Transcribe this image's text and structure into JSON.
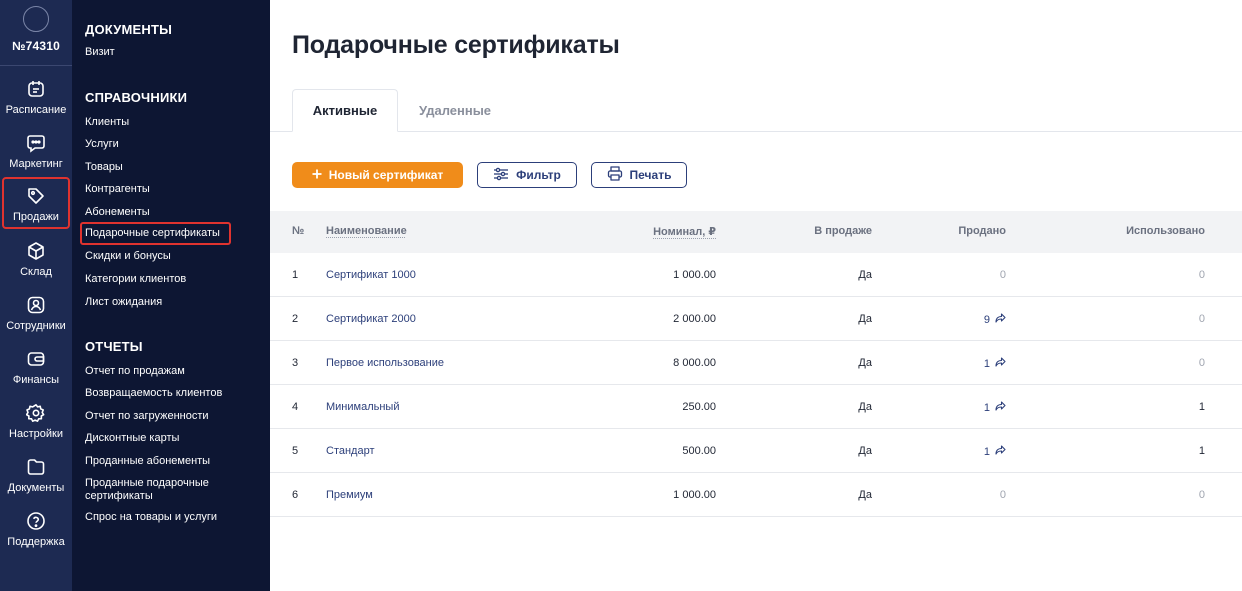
{
  "account": {
    "number": "№74310"
  },
  "rail": [
    {
      "name": "schedule",
      "icon": "calendar-icon",
      "label": "Расписание"
    },
    {
      "name": "marketing",
      "icon": "chat-icon",
      "label": "Маркетинг"
    },
    {
      "name": "sales",
      "icon": "tag-icon",
      "label": "Продажи",
      "active": true
    },
    {
      "name": "warehouse",
      "icon": "box-icon",
      "label": "Склад"
    },
    {
      "name": "staff",
      "icon": "person-icon",
      "label": "Сотрудники"
    },
    {
      "name": "finance",
      "icon": "wallet-icon",
      "label": "Финансы"
    },
    {
      "name": "settings",
      "icon": "gear-icon",
      "label": "Настройки"
    },
    {
      "name": "documents",
      "icon": "folder-icon",
      "label": "Документы"
    },
    {
      "name": "support",
      "icon": "question-icon",
      "label": "Поддержка"
    }
  ],
  "subnav": {
    "documents": {
      "title": "ДОКУМЕНТЫ",
      "items": [
        "Визит"
      ]
    },
    "references": {
      "title": "СПРАВОЧНИКИ",
      "items": [
        "Клиенты",
        "Услуги",
        "Товары",
        "Контрагенты",
        "Абонементы",
        "Подарочные сертификаты",
        "Скидки и бонусы",
        "Категории клиентов",
        "Лист ожидания"
      ]
    },
    "reports": {
      "title": "ОТЧЕТЫ",
      "items": [
        "Отчет по продажам",
        "Возвращаемость клиентов",
        "Отчет по загруженности",
        "Дисконтные карты",
        "Проданные абонементы",
        "Проданные подарочные сертификаты",
        "Спрос на товары и услуги"
      ]
    }
  },
  "page": {
    "title": "Подарочные сертификаты",
    "tabs": [
      "Активные",
      "Удаленные"
    ],
    "buttons": {
      "new": "Новый сертификат",
      "filter": "Фильтр",
      "print": "Печать"
    }
  },
  "table": {
    "headers": [
      "№",
      "Наименование",
      "Номинал, ₽",
      "В продаже",
      "Продано",
      "Использовано"
    ],
    "rows": [
      {
        "n": "1",
        "name": "Сертификат 1000",
        "nominal": "1 000.00",
        "on_sale": "Да",
        "sold": "0",
        "used": "0"
      },
      {
        "n": "2",
        "name": "Сертификат 2000",
        "nominal": "2 000.00",
        "on_sale": "Да",
        "sold": "9",
        "used": "0"
      },
      {
        "n": "3",
        "name": "Первое использование",
        "nominal": "8 000.00",
        "on_sale": "Да",
        "sold": "1",
        "used": "0"
      },
      {
        "n": "4",
        "name": "Минимальный",
        "nominal": "250.00",
        "on_sale": "Да",
        "sold": "1",
        "used": "1"
      },
      {
        "n": "5",
        "name": "Стандарт",
        "nominal": "500.00",
        "on_sale": "Да",
        "sold": "1",
        "used": "1"
      },
      {
        "n": "6",
        "name": "Премиум",
        "nominal": "1 000.00",
        "on_sale": "Да",
        "sold": "0",
        "used": "0"
      }
    ]
  },
  "colors": {
    "rail": "#1d2a52",
    "subnav": "#0d1633",
    "accent": "#f08c1a",
    "link": "#2c3f7a",
    "highlight": "#e0332f"
  }
}
